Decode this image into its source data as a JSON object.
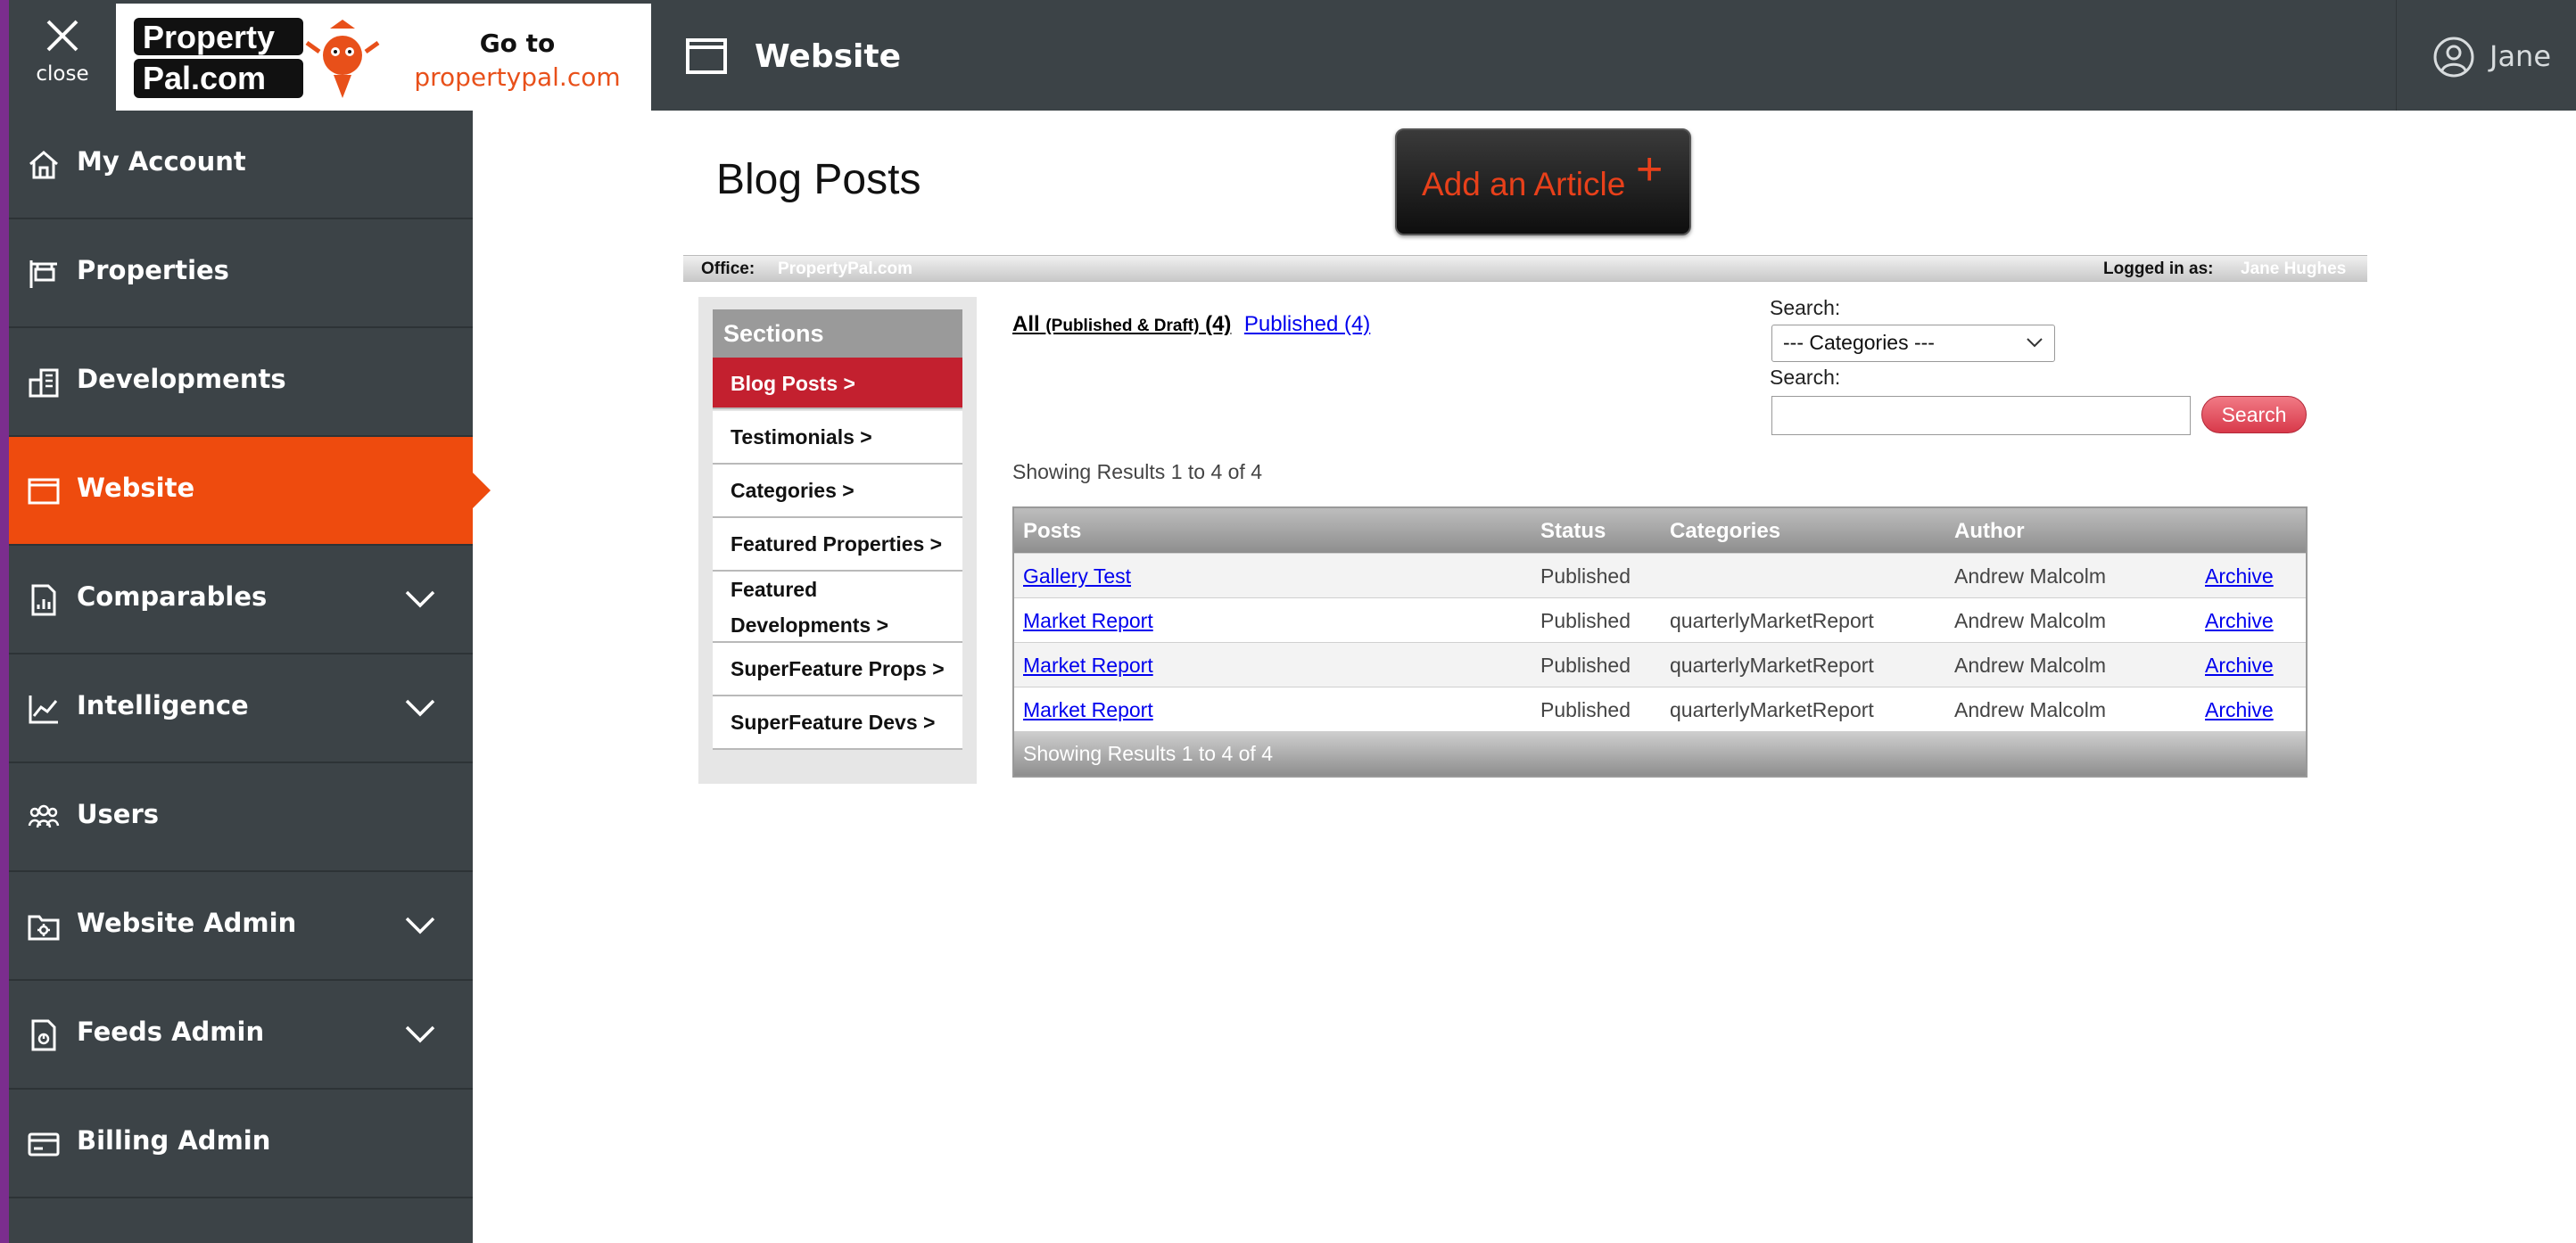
{
  "topbar": {
    "close_label": "close",
    "goto_line1": "Go to",
    "goto_line2": "propertypal.com",
    "page_title": "Website",
    "user_name": "Jane"
  },
  "sidebar": {
    "items": [
      {
        "label": "My Account",
        "icon": "home-icon"
      },
      {
        "label": "Properties",
        "icon": "sign-icon"
      },
      {
        "label": "Developments",
        "icon": "building-icon"
      },
      {
        "label": "Website",
        "icon": "window-icon",
        "active": true
      },
      {
        "label": "Comparables",
        "icon": "document-chart-icon",
        "expandable": true
      },
      {
        "label": "Intelligence",
        "icon": "line-chart-icon",
        "expandable": true
      },
      {
        "label": "Users",
        "icon": "users-icon"
      },
      {
        "label": "Website Admin",
        "icon": "folder-gear-icon",
        "expandable": true
      },
      {
        "label": "Feeds Admin",
        "icon": "document-rss-icon",
        "expandable": true
      },
      {
        "label": "Billing Admin",
        "icon": "credit-card-icon"
      }
    ]
  },
  "main": {
    "title": "Blog Posts",
    "add_article_label": "Add an Article",
    "add_article_plus": "+",
    "office_label": "Office:",
    "office_value": "PropertyPal.com",
    "logged_label": "Logged in as:",
    "logged_value": "Jane Hughes"
  },
  "sections": {
    "title": "Sections",
    "items": [
      {
        "label": "Blog Posts >",
        "active": true
      },
      {
        "label": "Testimonials >"
      },
      {
        "label": "Categories >"
      },
      {
        "label": "Featured Properties >"
      },
      {
        "label": "Featured Developments >"
      },
      {
        "label": "SuperFeature Props >"
      },
      {
        "label": "SuperFeature Devs >"
      }
    ]
  },
  "filters": {
    "all_label": "All",
    "all_sub": "(Published & Draft)",
    "all_count": "(4)",
    "published_label": "Published (4)",
    "search_label_1": "Search:",
    "category_selected": "--- Categories ---",
    "search_label_2": "Search:",
    "search_value": "",
    "search_button": "Search"
  },
  "results": {
    "showing_top": "Showing Results 1 to 4 of 4",
    "columns": [
      "Posts",
      "Status",
      "Categories",
      "Author"
    ],
    "rows": [
      {
        "post": "Gallery Test",
        "status": "Published",
        "category": "",
        "author": "Andrew Malcolm",
        "action": "Archive"
      },
      {
        "post": "Market Report",
        "status": "Published",
        "category": "quarterlyMarketReport",
        "author": "Andrew Malcolm",
        "action": "Archive"
      },
      {
        "post": "Market Report",
        "status": "Published",
        "category": "quarterlyMarketReport",
        "author": "Andrew Malcolm",
        "action": "Archive"
      },
      {
        "post": "Market Report",
        "status": "Published",
        "category": "quarterlyMarketReport",
        "author": "Andrew Malcolm",
        "action": "Archive"
      }
    ],
    "showing_bottom": "Showing Results 1 to 4 of 4"
  },
  "colors": {
    "topbar": "#3c4347",
    "accent": "#ee4b0e",
    "section_active": "#c3202f",
    "link": "#0000ee"
  }
}
